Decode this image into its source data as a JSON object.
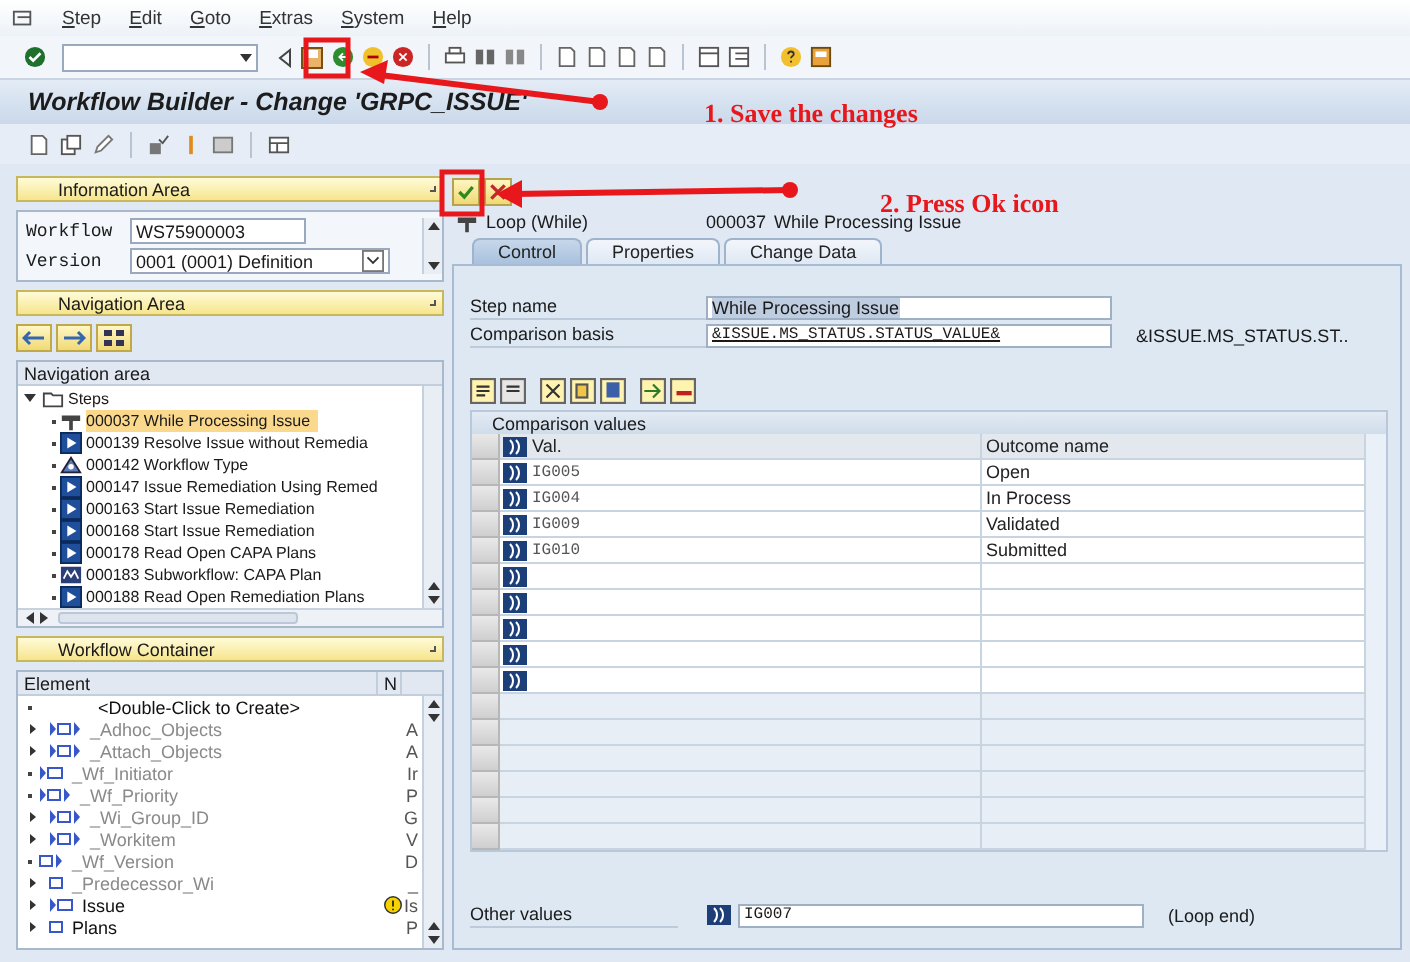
{
  "menu": [
    "Step",
    "Edit",
    "Goto",
    "Extras",
    "System",
    "Help"
  ],
  "title": "Workflow Builder - Change 'GRPC_ISSUE'",
  "annotations": [
    {
      "text": "1. Save the changes"
    },
    {
      "text": "2. Press Ok icon"
    }
  ],
  "information_area": {
    "header": "Information Area",
    "fields": [
      {
        "label": "Workflow",
        "value": "WS75900003",
        "kind": "text"
      },
      {
        "label": "Version",
        "value": "0001 (0001) Definition",
        "kind": "dropdown"
      }
    ]
  },
  "navigation_area": {
    "header": "Navigation Area",
    "tree_header": "Navigation area",
    "tree": [
      {
        "label": "Steps",
        "expanded": true,
        "children": [
          {
            "label": "000037 While Processing Issue",
            "kind": "loop",
            "selected": true
          },
          {
            "label": "000139 Resolve Issue without Remedia",
            "kind": "activity",
            "selected": false
          },
          {
            "label": "000142 Workflow Type",
            "kind": "network",
            "selected": false
          },
          {
            "label": "000147 Issue Remediation Using Remed",
            "kind": "activity",
            "selected": false
          },
          {
            "label": "000163 Start Issue Remediation",
            "kind": "activity",
            "selected": false
          },
          {
            "label": "000168 Start Issue Remediation",
            "kind": "activity",
            "selected": false
          },
          {
            "label": "000178 Read Open CAPA Plans",
            "kind": "activity",
            "selected": false
          },
          {
            "label": "000183 Subworkflow: CAPA Plan",
            "kind": "subworkflow",
            "selected": false
          },
          {
            "label": "000188 Read Open Remediation Plans",
            "kind": "activity",
            "selected": false
          }
        ]
      }
    ]
  },
  "workflow_container": {
    "header": "Workflow Container",
    "columns": [
      "Element",
      "N"
    ],
    "rows": [
      {
        "element": "<Double-Click to Create>",
        "kind": "placeholder",
        "expandable": false,
        "system": false,
        "warning": false
      },
      {
        "element": "_Adhoc_Objects",
        "column_2": "A",
        "kind": "multiline",
        "expandable": true,
        "system": true,
        "warning": false
      },
      {
        "element": "_Attach_Objects",
        "column_2": "A",
        "kind": "multiline",
        "expandable": true,
        "system": true,
        "warning": false
      },
      {
        "element": "_Wf_Initiator",
        "column_2": "Ir",
        "kind": "object",
        "expandable": false,
        "system": true,
        "warning": false
      },
      {
        "element": "_Wf_Priority",
        "column_2": "P",
        "kind": "multiline",
        "expandable": false,
        "system": true,
        "warning": false
      },
      {
        "element": "_Wi_Group_ID",
        "column_2": "G",
        "kind": "multiline",
        "expandable": true,
        "system": true,
        "warning": false
      },
      {
        "element": "_Workitem",
        "column_2": "V",
        "kind": "multiline",
        "expandable": true,
        "system": true,
        "warning": false
      },
      {
        "element": "_Wf_Version",
        "column_2": "D",
        "kind": "value",
        "expandable": false,
        "system": true,
        "warning": false
      },
      {
        "element": "_Predecessor_Wi",
        "column_2": "_",
        "kind": "box",
        "expandable": true,
        "system": true,
        "warning": false
      },
      {
        "element": "Issue",
        "column_2": "Is",
        "kind": "object",
        "expandable": true,
        "system": false,
        "warning": true
      },
      {
        "element": "Plans",
        "column_2": "P",
        "kind": "box",
        "expandable": true,
        "system": false,
        "warning": false
      }
    ]
  },
  "step": {
    "type": "Loop (While)",
    "number": "000037",
    "name": "While Processing Issue"
  },
  "tabs": [
    {
      "label": "Control",
      "selected": true
    },
    {
      "label": "Properties",
      "selected": false
    },
    {
      "label": "Change Data",
      "selected": false
    }
  ],
  "step_name": {
    "label": "Step name",
    "value": "While Processing Issue"
  },
  "comparison_basis": {
    "label": "Comparison basis",
    "value": "&ISSUE.MS_STATUS.STATUS_VALUE&",
    "description": "&ISSUE.MS_STATUS.ST.."
  },
  "comparison_values": {
    "title": "Comparison values",
    "columns": [
      "Val.",
      "Outcome name"
    ],
    "rows": [
      {
        "value": "IG005",
        "outcome": "Open"
      },
      {
        "value": "IG004",
        "outcome": "In Process"
      },
      {
        "value": "IG009",
        "outcome": "Validated"
      },
      {
        "value": "IG010",
        "outcome": "Submitted"
      }
    ]
  },
  "other_values": {
    "label": "Other values",
    "value": "IG007",
    "note": "(Loop end)"
  }
}
